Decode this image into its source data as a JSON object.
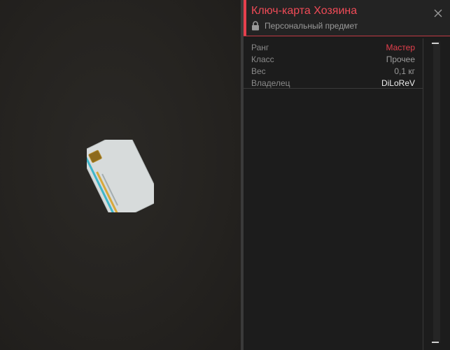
{
  "item": {
    "title": "Ключ-карта Хозяина",
    "subtitle": "Персональный предмет"
  },
  "properties": [
    {
      "label": "Ранг",
      "value": "Мастер"
    },
    {
      "label": "Класс",
      "value": "Прочее"
    },
    {
      "label": "Вес",
      "value": "0,1 кг"
    },
    {
      "label": "Владелец",
      "value": "DiLoReV"
    }
  ],
  "colors": {
    "accent": "#e5404d",
    "panel_bg": "#1c1c1c",
    "preview_bg": "#252320"
  },
  "icons": {
    "lock": "lock-icon",
    "close": "close-icon"
  }
}
